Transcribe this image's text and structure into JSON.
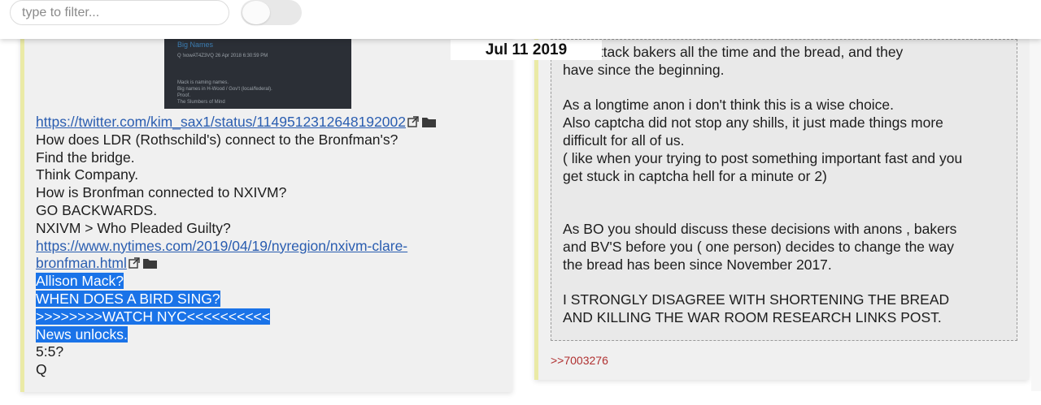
{
  "filter": {
    "placeholder": "type to filter..."
  },
  "date_label": "Jul 11 2019",
  "left_post": {
    "embed": {
      "title": "Big Names",
      "meta": "Q !xowAT4Z3VQ  26 Apr 2018  6:30:59 PM",
      "body": [
        "Mack is naming names.",
        "Big names in H-Wood / Gov't (local/federal).",
        "Proof.",
        "The Slumbers of Mind"
      ]
    },
    "lines": [
      {
        "text": "https://twitter.com/kim_sax1/status/1149512312648192002",
        "link": true,
        "icons": true
      },
      {
        "text": "How does LDR (Rothschild's) connect to the Bronfman's?"
      },
      {
        "text": "Find the bridge."
      },
      {
        "text": "Think Company."
      },
      {
        "text": "How is Bronfman connected to NXIVM?"
      },
      {
        "text": "GO BACKWARDS."
      },
      {
        "text": "NXIVM > Who Pleaded Guilty?"
      },
      {
        "text": "https://www.nytimes.com/2019/04/19/nyregion/nxivm-clare-",
        "link": true
      },
      {
        "text": "bronfman.html",
        "link": true,
        "icons": true
      },
      {
        "text": "Allison Mack?",
        "highlight": true
      },
      {
        "text": "WHEN DOES A BIRD SING?",
        "highlight": true
      },
      {
        "text": ">>>>>>>>WATCH NYC<<<<<<<<<<",
        "highlight": true
      },
      {
        "text": "News unlocks.",
        "highlight": true
      },
      {
        "text": "5:5?"
      },
      {
        "text": "Q"
      }
    ]
  },
  "right_post": {
    "lines": [
      "hills attack bakers all the time and the bread, and they",
      "have since the beginning.",
      "",
      "As a longtime anon i don't think this is a wise choice.",
      "Also captcha did not stop any shills, it just made things more",
      "difficult for all of us.",
      "( like when your trying to post something important fast and you",
      "get stuck in captcha hell for a minute or 2)",
      "",
      "",
      "As BO you should discuss these decisions with anons , bakers",
      "and BV'S before you ( one person) decides to change the way",
      "the bread has been since November 2017.",
      "",
      "I STRONGLY DISAGREE WITH SHORTENING THE BREAD",
      "AND KILLING THE WAR ROOM RESEARCH LINKS POST."
    ],
    "reply_link": ">>7003276"
  },
  "colors": {
    "link": "#2a5db0",
    "highlight": "#1a73e8",
    "reply": "#b03030",
    "card": "#f0f0f0",
    "accent_border": "#eaeaa6"
  }
}
